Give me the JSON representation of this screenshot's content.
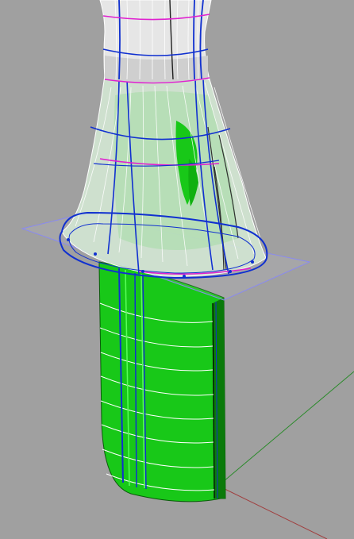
{
  "viewport": {
    "name": "perspective-3d-viewport",
    "colors": {
      "background": "#a0a0a0",
      "foil_green": "#18c818",
      "foil_green_dark": "#0a7a0a",
      "isocurve_blue": "#1030d0",
      "highlight_magenta": "#e020d0",
      "section_white": "#ffffff",
      "axis_green": "#2a8a2a",
      "axis_red": "#a04040"
    },
    "objects": [
      {
        "name": "upper-neck-surface",
        "kind": "nurbs-surface"
      },
      {
        "name": "flared-fillet-surface",
        "kind": "nurbs-surface"
      },
      {
        "name": "base-plane",
        "kind": "planar-surface"
      },
      {
        "name": "foil-strut",
        "kind": "extruded-surface"
      }
    ]
  }
}
